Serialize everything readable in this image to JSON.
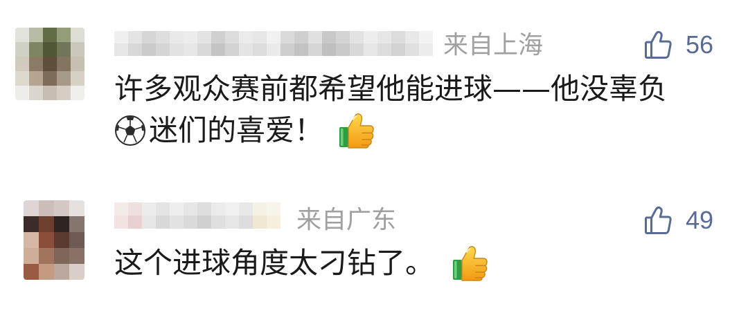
{
  "colors": {
    "background": "#ffffff",
    "comment_text": "#1a1a1a",
    "meta_text": "#a0a0a0",
    "like_accent": "#576b95"
  },
  "comments": [
    {
      "avatar": {
        "mosaic": [
          [
            "#e2e2dd",
            "#b8bca4",
            "#606d44",
            "#939d78",
            "#dddcd5"
          ],
          [
            "#d0d1c5",
            "#7c8661",
            "#4e5837",
            "#707657",
            "#cac7bc"
          ],
          [
            "#d2cabd",
            "#8a7b65",
            "#5e4f3b",
            "#84755f",
            "#c8bfb3"
          ],
          [
            "#ded9cf",
            "#b3a590",
            "#7c6c58",
            "#a69987",
            "#d6d0c7"
          ],
          [
            "#efede9",
            "#dad5cd",
            "#c6beb2",
            "#d4cec5",
            "#f0efec"
          ]
        ]
      },
      "name_blur": {
        "mosaic": [
          [
            "#efefef",
            "#e4e4e4",
            "#d6d6d6",
            "#dedede",
            "#e9e9e9",
            "#ececec",
            "#e3e3e3",
            "#d0d0d0",
            "#dcdcdc",
            "#ebebeb",
            "#e6e6e6",
            "#f1f1f1",
            "#dadada",
            "#cfcfcf",
            "#e0e0e0",
            "#c8c8c8",
            "#d4d4d4",
            "#e2e2e2",
            "#ededed",
            "#e6e6e6",
            "#dcdcdc",
            "#e8e8e8",
            "#f2f2f2"
          ],
          [
            "#e6e6e6",
            "#d8d8d8",
            "#cbcbcb",
            "#d5d5d5",
            "#e2e2e2",
            "#e7e7e7",
            "#d9d9d9",
            "#c4c4c4",
            "#d2d2d2",
            "#e4e4e4",
            "#dcdcdc",
            "#eaeaea",
            "#cecece",
            "#c3c3c3",
            "#d6d6d6",
            "#bfbfbf",
            "#cacaca",
            "#d8d8d8",
            "#e6e6e6",
            "#dddddd",
            "#d2d2d2",
            "#e0e0e0",
            "#ececec"
          ]
        ]
      },
      "location": "来自上海",
      "like": {
        "icon": "thumbs-up-outline",
        "count": 56
      },
      "text_parts": [
        {
          "text": "许多观众赛前都希望他能进球——他没辜负"
        },
        {
          "icon": "soccer-ball-emoji"
        },
        {
          "text": "迷们的喜爱！"
        },
        {
          "icon": "thumbs-up-emoji"
        }
      ]
    },
    {
      "avatar": {
        "mosaic": [
          [
            "#ddd5d3",
            "#cdbdb8",
            "#d4c8c4",
            "#e5e1df"
          ],
          [
            "#3b2c27",
            "#6e3f2e",
            "#2d2522",
            "#86756e"
          ],
          [
            "#d6b7a4",
            "#8b4f39",
            "#593b30",
            "#6e5a52"
          ],
          [
            "#cfae98",
            "#a1745e",
            "#7f665b",
            "#8a7167"
          ],
          [
            "#9b5b42",
            "#c39b81",
            "#bba89e",
            "#dacec8"
          ]
        ]
      },
      "name_blur": {
        "mosaic": [
          [
            "#f5eaea",
            "#efe0e0",
            "#ececec",
            "#e4e4e4",
            "#eeeeee",
            "#e6e6e6",
            "#dedede",
            "#ebebeb",
            "#f0f0f0",
            "#e8e8e8",
            "#f4f1e4",
            "#f7f4ea"
          ],
          [
            "#f3e2e3",
            "#e8cfd2",
            "#e6e6e6",
            "#d8d8d8",
            "#e2e2e2",
            "#dadada",
            "#d0d0d0",
            "#dfdfdf",
            "#e6e6e6",
            "#dddddd",
            "#efe9d2",
            "#f5f0de"
          ]
        ]
      },
      "location": "来自广东",
      "like": {
        "icon": "thumbs-up-outline",
        "count": 49
      },
      "text_parts": [
        {
          "text": "这个进球角度太刁钻了。"
        },
        {
          "icon": "thumbs-up-emoji"
        }
      ]
    }
  ]
}
